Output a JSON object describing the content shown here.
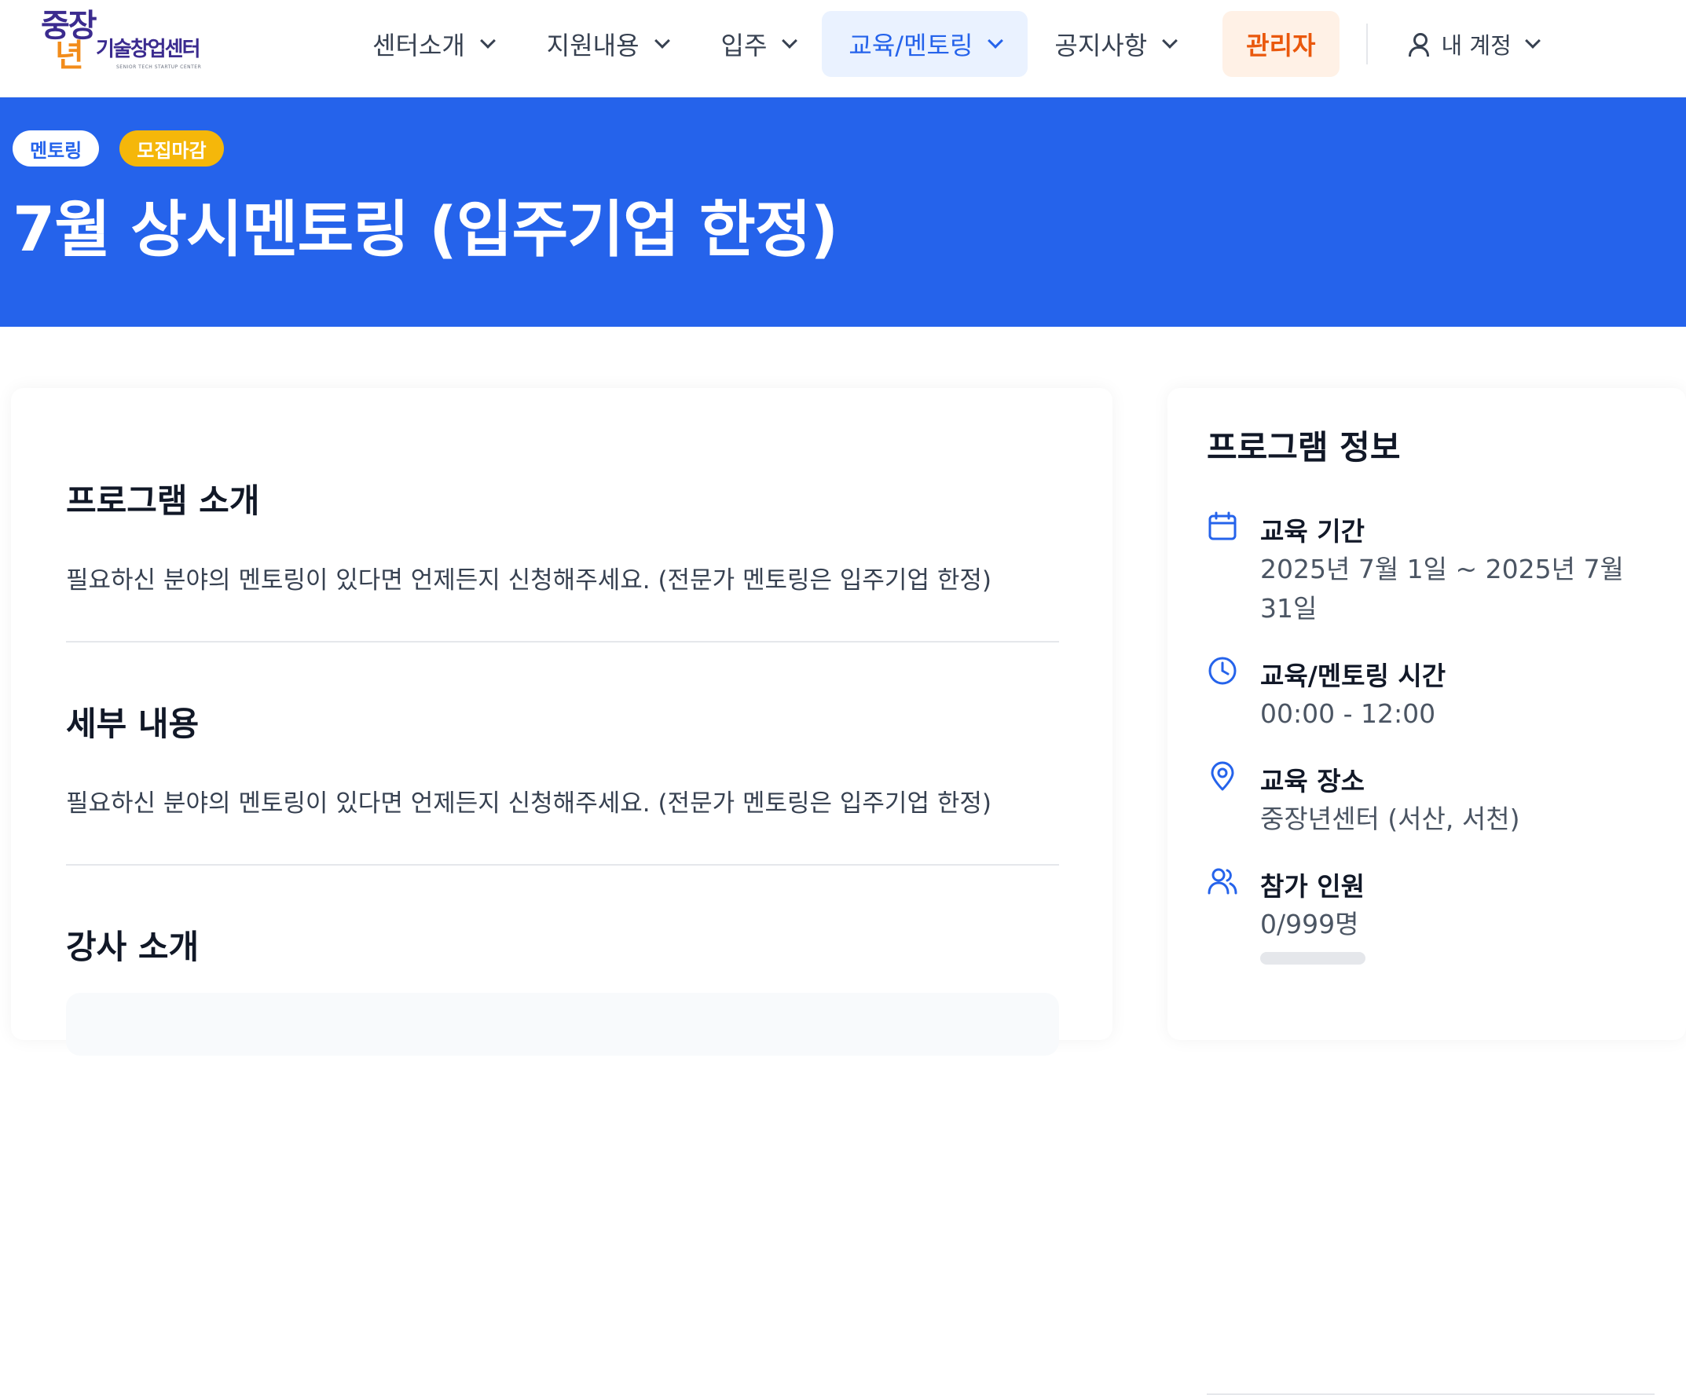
{
  "logo": {
    "mark_top": "중장",
    "mark_bottom": "년",
    "wordmark": "기술창업센터",
    "tagline": "SENIOR TECH STARTUP CENTER"
  },
  "nav": {
    "items": [
      {
        "label": "센터소개"
      },
      {
        "label": "지원내용"
      },
      {
        "label": "입주"
      },
      {
        "label": "교육/멘토링",
        "active": true
      },
      {
        "label": "공지사항"
      }
    ],
    "admin_label": "관리자",
    "account_label": "내 계정",
    "account_icon": "user-icon"
  },
  "hero": {
    "tag": "멘토링",
    "status": "모집마감",
    "title": "7월 상시멘토링 (입주기업 한정)"
  },
  "sections": {
    "intro": {
      "heading": "프로그램 소개",
      "body": "필요하신 분야의 멘토링이 있다면 언제든지 신청해주세요. (전문가 멘토링은 입주기업 한정)"
    },
    "details": {
      "heading": "세부 내용",
      "body": "필요하신 분야의 멘토링이 있다면 언제든지 신청해주세요. (전문가 멘토링은 입주기업 한정)"
    },
    "instructor": {
      "heading": "강사 소개"
    }
  },
  "program_info": {
    "heading": "프로그램 정보",
    "period": {
      "label": "교육 기간",
      "value": "2025년 7월 1일 ~ 2025년 7월 31일",
      "icon": "calendar-icon"
    },
    "time": {
      "label": "교육/멘토링 시간",
      "value": "00:00 - 12:00",
      "icon": "clock-icon"
    },
    "place": {
      "label": "교육 장소",
      "value": "중장년센터 (서산, 서천)",
      "icon": "location-pin-icon"
    },
    "participants": {
      "label": "참가 인원",
      "value": "0/999명",
      "icon": "users-icon",
      "fill_fraction": 0.0
    }
  },
  "colors": {
    "primary": "#2563eb",
    "status_yellow": "#f5b70a",
    "admin_orange": "#ea580c",
    "logo_purple": "#3b2b8f"
  }
}
